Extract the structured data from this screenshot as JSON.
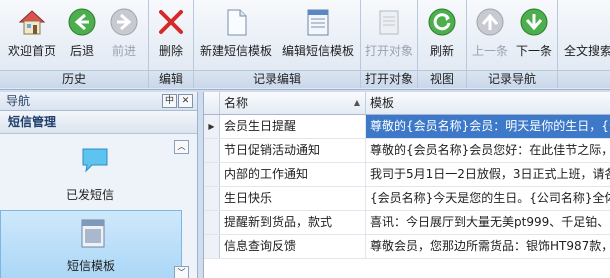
{
  "ribbon": {
    "groups": [
      {
        "caption": "历史",
        "buttons": [
          "欢迎首页",
          "后退",
          "前进"
        ]
      },
      {
        "caption": "编辑",
        "buttons": [
          "删除"
        ]
      },
      {
        "caption": "记录编辑",
        "buttons": [
          "新建短信模板",
          "编辑短信模板"
        ]
      },
      {
        "caption": "打开对象",
        "buttons": [
          "打开对象"
        ]
      },
      {
        "caption": "视图",
        "buttons": [
          "刷新"
        ]
      },
      {
        "caption": "记录导航",
        "buttons": [
          "上一条",
          "下一条"
        ]
      },
      {
        "caption": "",
        "buttons": [
          "全文搜索"
        ]
      }
    ]
  },
  "nav": {
    "title": "导航",
    "pin_glyph": "中",
    "close_glyph": "✕",
    "section": "短信管理",
    "items": [
      {
        "label": "已发短信",
        "icon": "chat-bubble-icon",
        "selected": false
      },
      {
        "label": "短信模板",
        "icon": "document-template-icon",
        "selected": true
      }
    ]
  },
  "grid": {
    "columns": [
      "名称",
      "模板"
    ],
    "rows": [
      {
        "name": "会员生日提醒",
        "template": "尊敬的{会员名称}会员：明天是你的生日，{公",
        "selected": true
      },
      {
        "name": "节日促销活动通知",
        "template": "尊敬的{会员名称}会员您好：在此佳节之际，",
        "selected": false
      },
      {
        "name": "内部的工作通知",
        "template": "我司于5月1日一2日放假，3日正式上班，请各",
        "selected": false
      },
      {
        "name": "生日快乐",
        "template": "{会员名称}今天是您的生日。{公司名称}全体",
        "selected": false
      },
      {
        "name": "提醒新到货品，款式",
        "template": "喜讯：今日展厅到大量无美pt999、千足铂、只",
        "selected": false
      },
      {
        "name": "信息查询反馈",
        "template": "尊敬会员，您那边所需货品：银饰HT987款，",
        "selected": false
      }
    ]
  },
  "colors": {
    "accent": "#3d79c8",
    "ribbon_bg": "#e8eef6",
    "nav_selected": "#a9d6f6"
  }
}
